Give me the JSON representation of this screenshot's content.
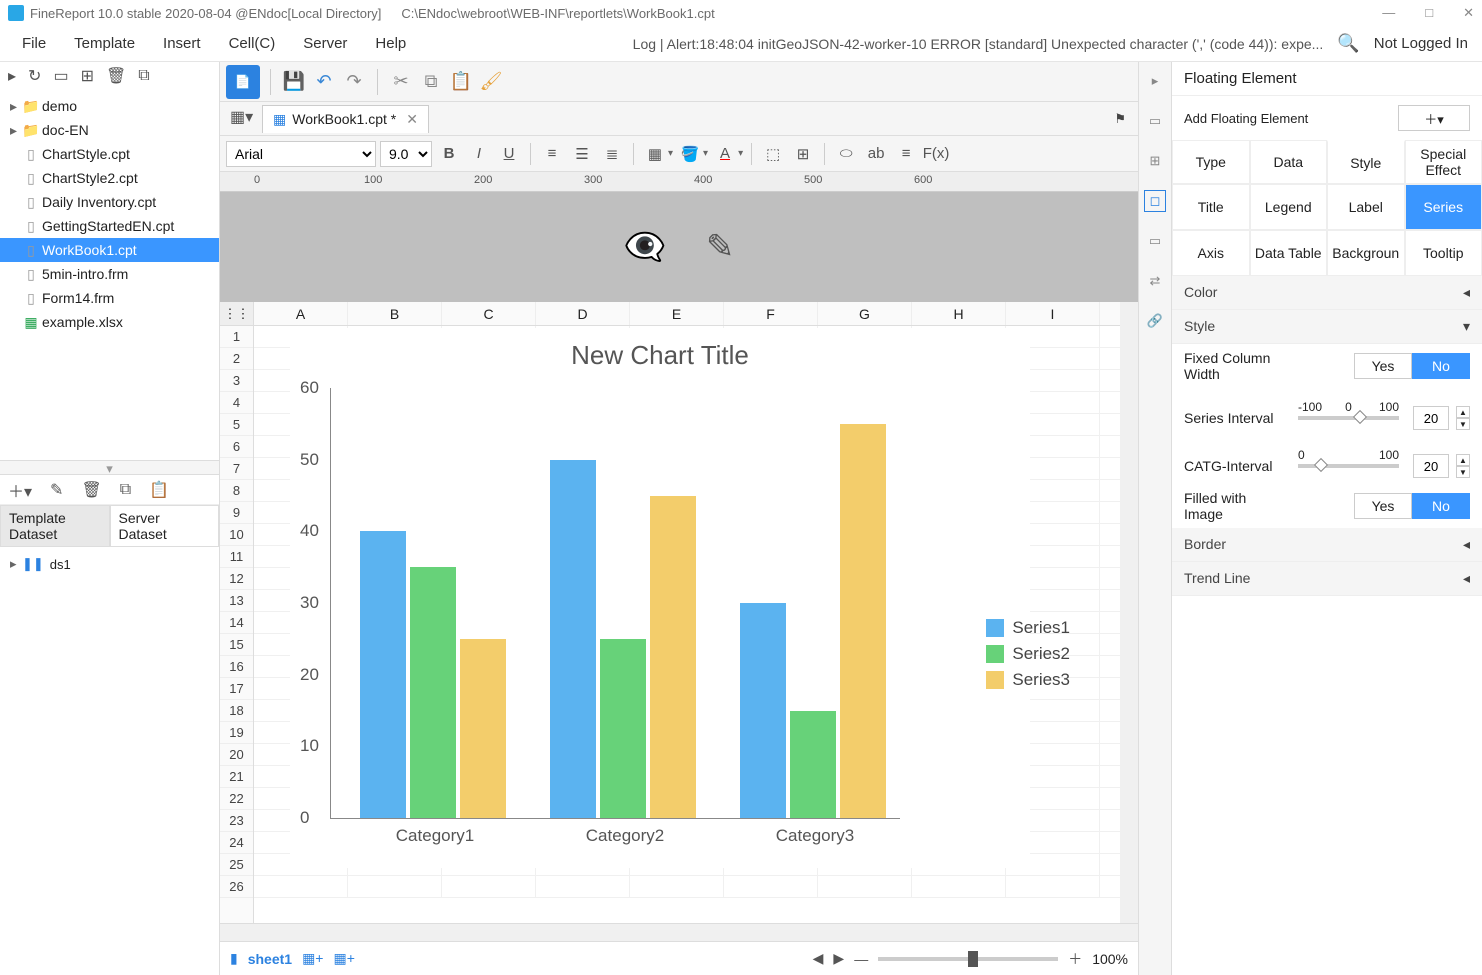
{
  "titlebar": {
    "app": "FineReport 10.0 stable 2020-08-04 @ENdoc[Local Directory]",
    "path": "C:\\ENdoc\\webroot\\WEB-INF\\reportlets\\WorkBook1.cpt"
  },
  "wincontrols": {
    "min": "—",
    "max": "□",
    "close": "✕"
  },
  "menu": {
    "items": [
      "File",
      "Template",
      "Insert",
      "Cell(C)",
      "Server",
      "Help"
    ],
    "log": "Log | Alert:18:48:04 initGeoJSON-42-worker-10 ERROR [standard] Unexpected character (',' (code 44)): expe...",
    "notlogged": "Not Logged In"
  },
  "left_toolbar": {
    "icons": [
      "▸",
      "↻",
      "▭",
      "⊞",
      "🗑",
      "⧉"
    ]
  },
  "tree": [
    {
      "type": "folder",
      "label": "demo",
      "arrow": "▸"
    },
    {
      "type": "folder",
      "label": "doc-EN",
      "arrow": "▸"
    },
    {
      "type": "file",
      "label": "ChartStyle.cpt"
    },
    {
      "type": "file",
      "label": "ChartStyle2.cpt"
    },
    {
      "type": "file",
      "label": "Daily Inventory.cpt"
    },
    {
      "type": "file",
      "label": "GettingStartedEN.cpt"
    },
    {
      "type": "file",
      "label": "WorkBook1.cpt",
      "selected": true
    },
    {
      "type": "file",
      "label": "5min-intro.frm"
    },
    {
      "type": "file",
      "label": "Form14.frm"
    },
    {
      "type": "xls",
      "label": "example.xlsx"
    }
  ],
  "ds_tabs": {
    "template": "Template Dataset",
    "server": "Server Dataset"
  },
  "ds_items": [
    {
      "label": "ds1"
    }
  ],
  "doc_tab": {
    "label": "WorkBook1.cpt *"
  },
  "format": {
    "font": "Arial",
    "size": "9.0"
  },
  "ruler_ticks": [
    "0",
    "100",
    "200",
    "300",
    "400",
    "500",
    "600"
  ],
  "columns": [
    "A",
    "B",
    "C",
    "D",
    "E",
    "F",
    "G",
    "H",
    "I"
  ],
  "row_count": 26,
  "chart_data": {
    "type": "bar",
    "title": "New Chart Title",
    "categories": [
      "Category1",
      "Category2",
      "Category3"
    ],
    "series": [
      {
        "name": "Series1",
        "values": [
          40,
          50,
          30
        ],
        "color": "#5bb3f0"
      },
      {
        "name": "Series2",
        "values": [
          35,
          25,
          15
        ],
        "color": "#67d279"
      },
      {
        "name": "Series3",
        "values": [
          25,
          45,
          55
        ],
        "color": "#f3cd6b"
      }
    ],
    "ylim": [
      0,
      60
    ],
    "yticks": [
      0,
      10,
      20,
      30,
      40,
      50,
      60
    ]
  },
  "bottom": {
    "sheet": "sheet1",
    "zoom": "100%"
  },
  "rightpanel": {
    "header": "Floating Element",
    "add_label": "Add Floating Element",
    "add_btn": "＋▾",
    "tabs1": [
      "Type",
      "Data",
      "Style",
      "Special Effect"
    ],
    "tabs1_active": 2,
    "tabs2": [
      "Title",
      "Legend",
      "Label",
      "Series",
      "Axis",
      "Data Table",
      "Backgroun",
      "Tooltip"
    ],
    "tabs2_active": 3,
    "sections": {
      "color": "Color",
      "style": "Style",
      "fixed_col": "Fixed Column Width",
      "fixed_col_val": "No",
      "series_int_lab": "Series Interval",
      "series_int": {
        "min": "-100",
        "mid": "0",
        "max": "100",
        "val": "20"
      },
      "catg_int_lab": "CATG-Interval",
      "catg_int": {
        "min": "0",
        "max": "100",
        "val": "20"
      },
      "fill_img": "Filled with Image",
      "fill_img_val": "No",
      "border": "Border",
      "trend": "Trend Line",
      "yes": "Yes",
      "no": "No"
    }
  }
}
